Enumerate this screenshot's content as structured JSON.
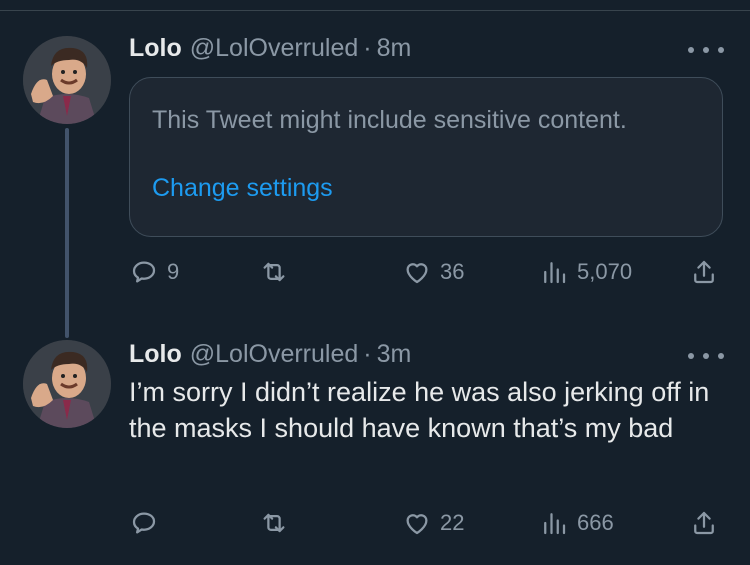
{
  "tweets": [
    {
      "name": "Lolo",
      "handle": "@LolOverruled",
      "separator": "·",
      "time": "8m",
      "sensitive_notice": "This Tweet might include sensitive content.",
      "sensitive_link": "Change settings",
      "replies": "9",
      "retweets": "",
      "likes": "36",
      "views": "5,070"
    },
    {
      "name": "Lolo",
      "handle": "@LolOverruled",
      "separator": "·",
      "time": "3m",
      "text": "I’m sorry I didn’t realize he was also jerking off in the masks I should have known that’s my bad",
      "replies": "",
      "retweets": "",
      "likes": "22",
      "views": "666"
    }
  ],
  "colors": {
    "background": "#15202b",
    "link": "#1d9bf0",
    "muted": "#8b98a5",
    "text": "#e7e9ea"
  },
  "icons": [
    "reply-icon",
    "retweet-icon",
    "like-icon",
    "views-icon",
    "share-icon",
    "more-options-icon"
  ]
}
